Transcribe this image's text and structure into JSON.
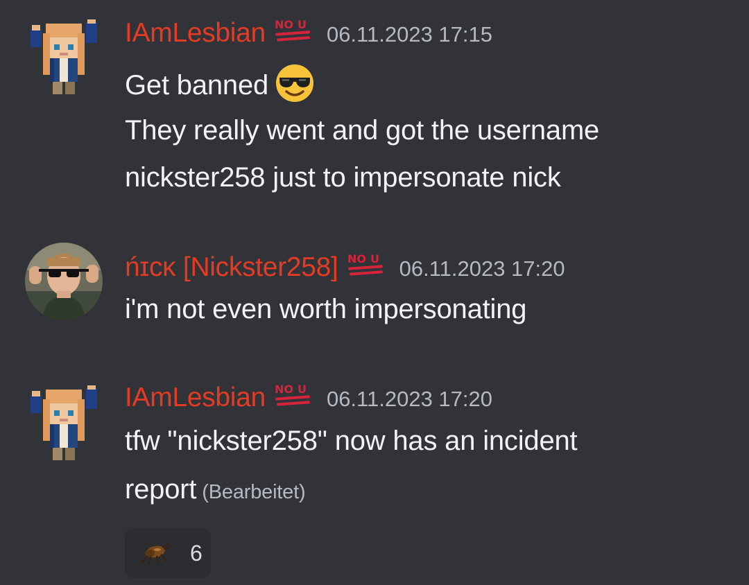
{
  "messages": [
    {
      "author": "IAmLesbian",
      "role_icon": "hundred-no-u-icon",
      "timestamp": "06.11.2023 17:15",
      "avatar": "pixel-character-avatar",
      "lines": [
        {
          "text": "Get banned",
          "emoji": "sunglasses-emoji"
        },
        {
          "text": "They really went and got the username"
        },
        {
          "text": "nickster258 just to impersonate nick"
        }
      ]
    },
    {
      "author": "ńɪᴄᴋ [Nickster258]",
      "role_icon": "hundred-no-u-icon",
      "timestamp": "06.11.2023 17:20",
      "avatar": "photo-avatar-sunglasses",
      "lines": [
        {
          "text": "i'm not even worth impersonating"
        }
      ]
    },
    {
      "author": "IAmLesbian",
      "role_icon": "hundred-no-u-icon",
      "timestamp": "06.11.2023 17:20",
      "avatar": "pixel-character-avatar",
      "lines": [
        {
          "text": "tfw \"nickster258\" now has an incident"
        },
        {
          "text": "report",
          "edited": "(Bearbeitet)"
        }
      ],
      "reaction": {
        "emoji": "flea-emoji",
        "count": "6"
      }
    }
  ],
  "colors": {
    "background": "#313338",
    "username": "#e23c24",
    "timestamp": "#b5bac1",
    "message_text": "#f2f3f5",
    "reaction_bg": "#2b2d31"
  }
}
